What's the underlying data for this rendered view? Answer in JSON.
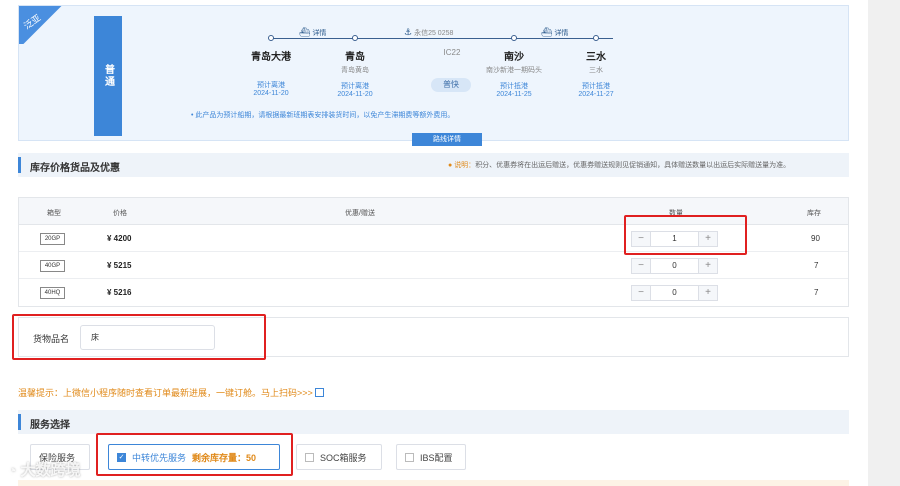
{
  "route": {
    "ribbon": "泛亚",
    "service_tag": "普通",
    "legs": [
      {
        "label": "详情",
        "kind": "barge"
      },
      {
        "label": "永信25 0258",
        "kind": "vessel"
      },
      {
        "label": "详情",
        "kind": "barge"
      }
    ],
    "ports": [
      {
        "name": "青岛大港",
        "sub": "",
        "status": "预计离港",
        "date": "2024-11-20"
      },
      {
        "name": "青岛",
        "sub": "青岛黄岛",
        "status": "预计离港",
        "date": "2024-11-20"
      },
      {
        "name": "南沙",
        "sub": "南沙新港一期码头",
        "status": "预计抵港",
        "date": "2024-11-25"
      },
      {
        "name": "三水",
        "sub": "三水",
        "status": "预计抵港",
        "date": "2024-11-27"
      }
    ],
    "voyage_code": "IC22",
    "speed": "普快",
    "note": "此产品为预计船期，请根据最新班期表安排装货时间，以免产生滞期费等额外费用。",
    "detail_button": "路线详情"
  },
  "inventory": {
    "title": "库存价格货品及优惠",
    "notice_label": "说明：",
    "notice_text": "积分、优惠券将在出运后赠送，优惠券赠送规则见促销通知，具体赠送数量以出运后实际赠送量为准。",
    "columns": [
      "箱型",
      "价格",
      "优惠/赠送",
      "数量",
      "库存"
    ],
    "rows": [
      {
        "type": "20GP",
        "price": "¥ 4200",
        "qty": "1",
        "stock": "90"
      },
      {
        "type": "40GP",
        "price": "¥ 5215",
        "qty": "0",
        "stock": "7"
      },
      {
        "type": "40HQ",
        "price": "¥ 5216",
        "qty": "0",
        "stock": "7"
      }
    ]
  },
  "cargo": {
    "label": "货物品名",
    "value": "床"
  },
  "tip": "温馨提示：上微信小程序随时查看订单最新进展，一键订舱。马上扫码>>>",
  "services": {
    "title": "服务选择",
    "items": [
      {
        "label": "保险服务",
        "checked": false,
        "extra": ""
      },
      {
        "label": "中转优先服务",
        "checked": true,
        "extra": "剩余库存量：50"
      },
      {
        "label": "SOC箱服务",
        "checked": false,
        "extra": ""
      },
      {
        "label": "IBS配置",
        "checked": false,
        "extra": ""
      }
    ]
  },
  "watermark": "大数跨境",
  "colors": {
    "accent": "#3d86d8",
    "highlight": "#e02020",
    "warning": "#e08a1a"
  }
}
